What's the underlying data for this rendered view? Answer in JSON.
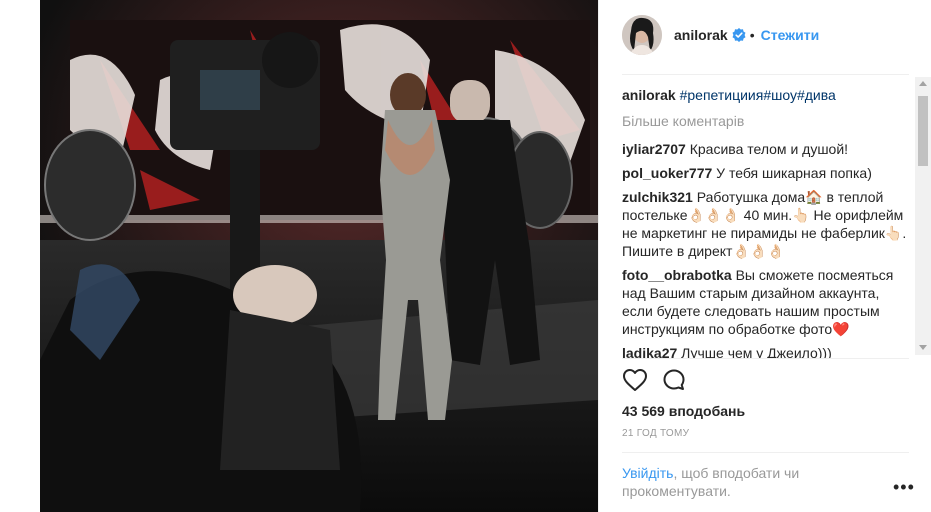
{
  "post": {
    "username": "anilorak",
    "follow_label": "Стежити",
    "dot": "•",
    "caption": {
      "username": "anilorak",
      "hashtags": "#репетициия#шоу#дива"
    },
    "more_comments_label": "Більше коментарів",
    "comments": [
      {
        "user": "iyliar2707",
        "text": "Красива телом и душой!"
      },
      {
        "user": "pol_uoker777",
        "text": "У тебя шикарная попка)"
      },
      {
        "user": "zulchik321",
        "text": "Работушка дома🏠 в теплой постельке👌🏻👌🏻👌🏻 40 мин.👆🏻 Не орифлейм не маркетинг не пирамиды не фаберлик👆🏻. Пишите в директ👌🏻👌🏻👌🏻"
      },
      {
        "user": "foto__obrabotka",
        "text": "Вы сможете посмеяться над Вашим старым дизайном аккаунта, если будете следовать нашим простым инструкциям по обработке фото❤️"
      },
      {
        "user": "ladika27",
        "text": "Лучше чем у Джеило)))"
      }
    ],
    "likes": "43 569 вподобань",
    "time_ago": "21 ГОД ТОМУ",
    "login_link": "Увійдіть",
    "login_text": ", щоб вподобати чи прокоментувати.",
    "more_options": "•••"
  },
  "colors": {
    "link_blue": "#3897f0",
    "hashtag_blue": "#003569",
    "muted": "#999999",
    "text": "#262626",
    "verified": "#3897f0"
  },
  "icons": {
    "like": "heart-icon",
    "comment": "comment-bubble-icon",
    "verified": "verified-badge-icon",
    "more": "more-options-icon"
  }
}
